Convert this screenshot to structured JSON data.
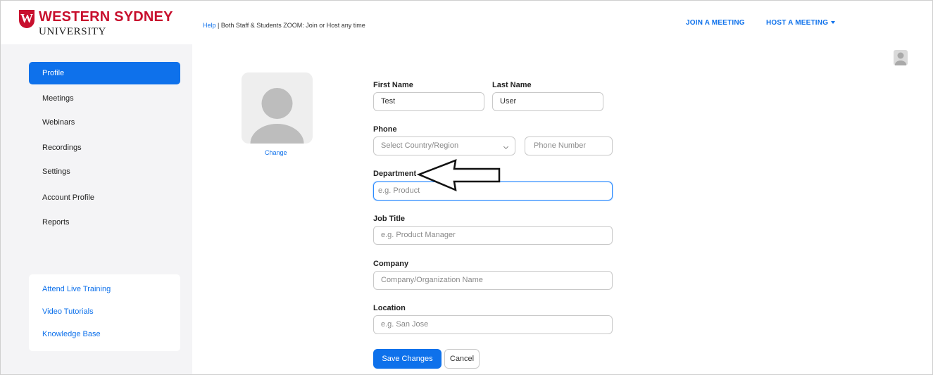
{
  "header": {
    "logo_line1": "WESTERN SYDNEY",
    "logo_line2": "UNIVERSITY",
    "logo_mark": "W",
    "help_link": "Help",
    "help_text": " | Both Staff & Students ZOOM: Join or Host any time",
    "join_meeting": "JOIN A MEETING",
    "host_meeting": "HOST A MEETING"
  },
  "sidebar": {
    "items": [
      {
        "label": "Profile",
        "active": true
      },
      {
        "label": "Meetings"
      },
      {
        "label": "Webinars"
      },
      {
        "label": "Recordings"
      },
      {
        "label": "Settings"
      },
      {
        "label": "Account Profile"
      },
      {
        "label": "Reports"
      }
    ],
    "help_links": [
      "Attend Live Training",
      "Video Tutorials",
      "Knowledge Base"
    ]
  },
  "profile": {
    "change_label": "Change",
    "first_name_label": "First Name",
    "first_name_value": "Test",
    "last_name_label": "Last Name",
    "last_name_value": "User",
    "phone_label": "Phone",
    "country_select": "Select Country/Region",
    "phone_placeholder": "Phone Number",
    "department_label": "Department",
    "department_placeholder": "e.g. Product",
    "job_title_label": "Job Title",
    "job_title_placeholder": "e.g. Product Manager",
    "company_label": "Company",
    "company_placeholder": "Company/Organization Name",
    "location_label": "Location",
    "location_placeholder": "e.g. San Jose",
    "save_label": "Save Changes",
    "cancel_label": "Cancel"
  },
  "colors": {
    "brand_red": "#c8102e",
    "accent_blue": "#0e71eb",
    "sidebar_bg": "#f4f4f6"
  },
  "icons": {
    "avatar": "user-silhouette-icon",
    "caret": "chevron-down-icon",
    "annotation": "left-arrow-outline-icon"
  }
}
